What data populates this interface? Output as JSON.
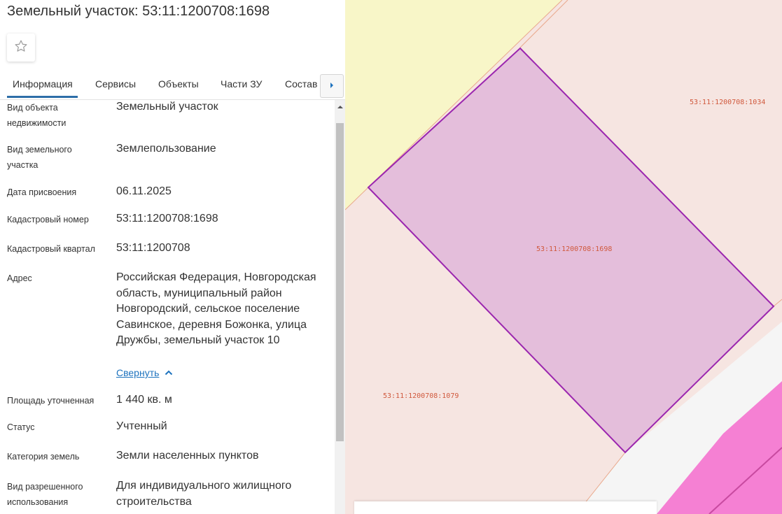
{
  "header": {
    "title": "Земельный участок: 53:11:1200708:1698"
  },
  "tabs": [
    {
      "label": "Информация"
    },
    {
      "label": "Сервисы"
    },
    {
      "label": "Объекты"
    },
    {
      "label": "Части ЗУ"
    },
    {
      "label": "Состав"
    }
  ],
  "properties": [
    {
      "label": "Вид объекта недвижимости",
      "value": "Земельный участок"
    },
    {
      "label": "Вид земельного участка",
      "value": "Землепользование"
    },
    {
      "label": "Дата присвоения",
      "value": "06.11.2025"
    },
    {
      "label": "Кадастровый номер",
      "value": "53:11:1200708:1698"
    },
    {
      "label": "Кадастровый квартал",
      "value": "53:11:1200708"
    },
    {
      "label": "Адрес",
      "value": "Российская Федерация, Новгородская область, муниципальный район Новгородский, сельское поселение Савинское, деревня Божонка, улица Дружбы, земельный участок 10"
    },
    {
      "label": "Площадь уточненная",
      "value": "1 440 кв. м"
    },
    {
      "label": "Статус",
      "value": "Учтенный"
    },
    {
      "label": "Категория земель",
      "value": "Земли населенных пунктов"
    },
    {
      "label": "Вид разрешенного использования",
      "value": "Для индивидуального жилищного строительства"
    }
  ],
  "address_toggle": {
    "label": "Свернуть"
  },
  "map": {
    "labels": {
      "selected": "53:11:1200708:1698",
      "north_east": "53:11:1200708:1034",
      "south_west": "53:11:1200708:1079"
    },
    "colors": {
      "selected_fill": "#e4bedb",
      "selected_stroke": "#9b26af",
      "parcel_fill": "#f6e5e1",
      "zone_fill": "#f8f6c8",
      "road_fill": "#f5f5f5",
      "magenta_zone": "#f580d3",
      "label_color": "#d0593d"
    }
  }
}
